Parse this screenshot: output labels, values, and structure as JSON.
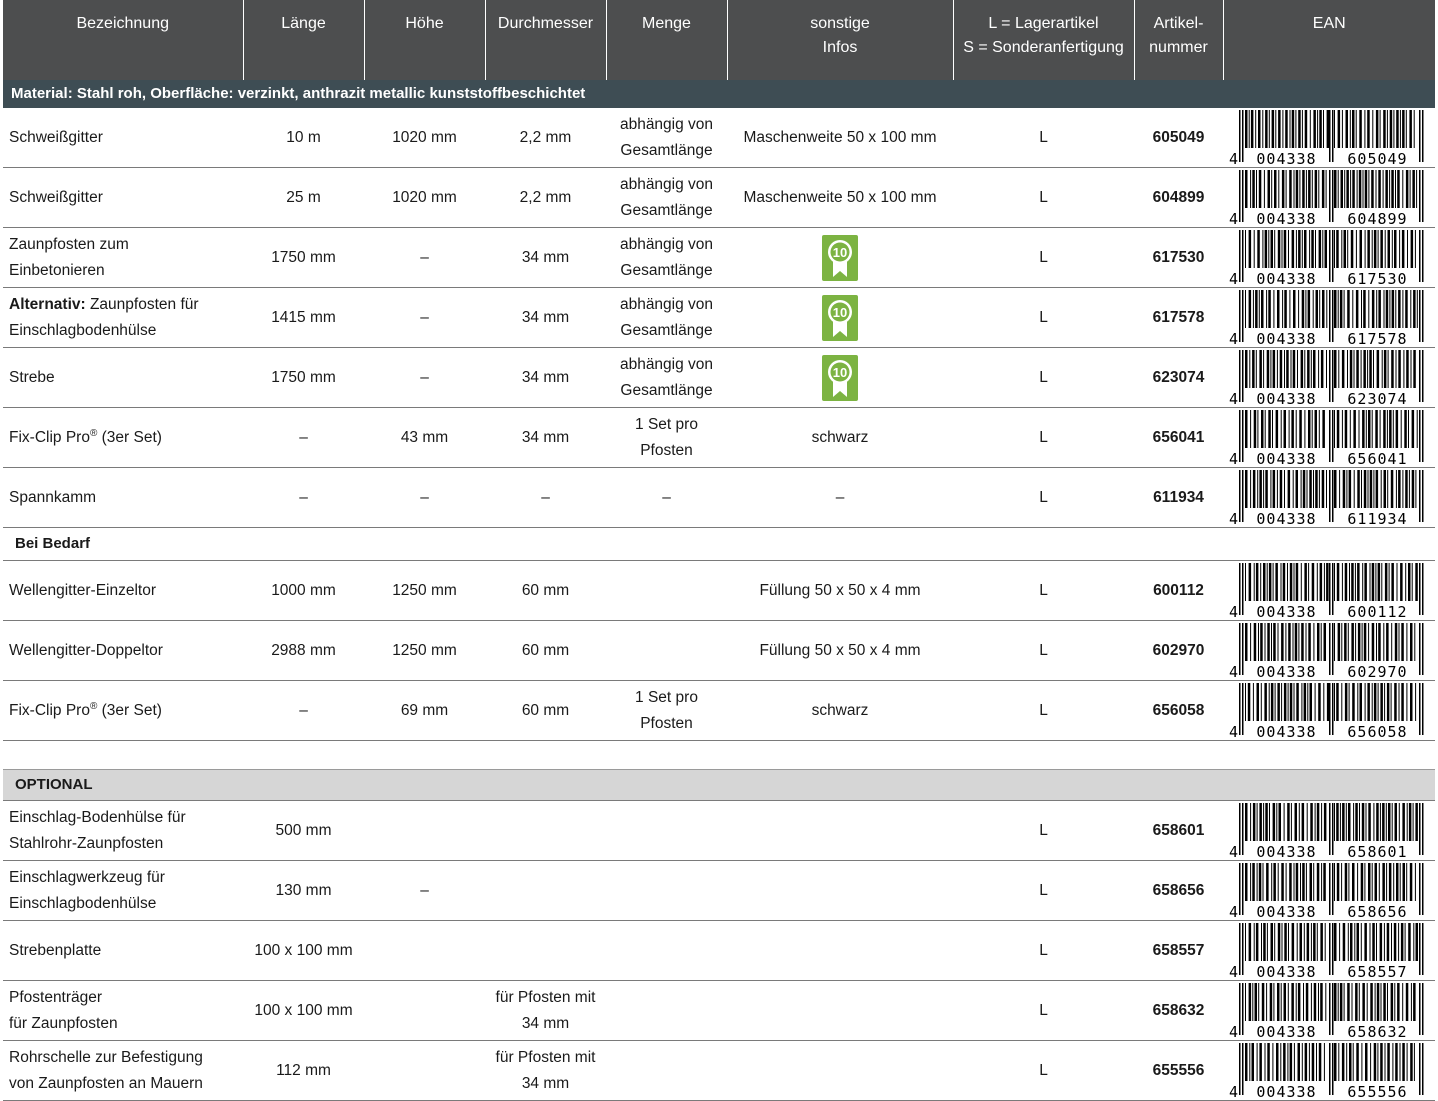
{
  "headers": {
    "bezeichnung": "Bezeichnung",
    "laenge": "Länge",
    "hoehe": "Höhe",
    "durchmesser": "Durchmesser",
    "menge": "Menge",
    "infos_1": "sonstige",
    "infos_2": "Infos",
    "lager_1": "L = Lagerartikel",
    "lager_2": "S = Sonderanfertigung",
    "artikel_1": "Artikel-",
    "artikel_2": "nummer",
    "ean": "EAN"
  },
  "sections": {
    "material": "Material: Stahl roh, Oberfläche: verzinkt, anthrazit metallic kunststoffbeschichtet",
    "bedarf": "Bei Bedarf",
    "optional": "OPTIONAL"
  },
  "award_icon": "award-rosette-10-icon",
  "award_label": "10",
  "accent_green": "#7cb342",
  "rows": [
    {
      "name1": "Schweißgitter",
      "name2": "",
      "laenge": "10 m",
      "hoehe": "1020 mm",
      "durchmesser": "2,2 mm",
      "menge1": "abhängig von",
      "menge2": "Gesamtlänge",
      "infos": "Maschenweite 50 x 100 mm",
      "lager": "L",
      "artikel": "605049",
      "ean_prefix": "4",
      "ean_mid": "004338",
      "ean_end": "605049"
    },
    {
      "name1": "Schweißgitter",
      "name2": "",
      "laenge": "25 m",
      "hoehe": "1020 mm",
      "durchmesser": "2,2 mm",
      "menge1": "abhängig von",
      "menge2": "Gesamtlänge",
      "infos": "Maschenweite 50 x 100 mm",
      "lager": "L",
      "artikel": "604899",
      "ean_prefix": "4",
      "ean_mid": "004338",
      "ean_end": "604899"
    },
    {
      "name1": "Zaunpfosten zum",
      "name2": "Einbetonieren",
      "laenge": "1750 mm",
      "hoehe": "–",
      "durchmesser": "34 mm",
      "menge1": "abhängig von",
      "menge2": "Gesamtlänge",
      "infos": "",
      "lager": "L",
      "artikel": "617530",
      "ean_prefix": "4",
      "ean_mid": "004338",
      "ean_end": "617530"
    },
    {
      "name_bold": "Alternativ:",
      "name1": " Zaunpfosten für",
      "name2": "Einschlagbodenhülse",
      "laenge": "1415 mm",
      "hoehe": "–",
      "durchmesser": "34 mm",
      "menge1": "abhängig von",
      "menge2": "Gesamtlänge",
      "infos": "",
      "lager": "L",
      "artikel": "617578",
      "ean_prefix": "4",
      "ean_mid": "004338",
      "ean_end": "617578"
    },
    {
      "name1": "Strebe",
      "name2": "",
      "laenge": "1750 mm",
      "hoehe": "–",
      "durchmesser": "34 mm",
      "menge1": "abhängig von",
      "menge2": "Gesamtlänge",
      "infos": "",
      "lager": "L",
      "artikel": "623074",
      "ean_prefix": "4",
      "ean_mid": "004338",
      "ean_end": "623074"
    },
    {
      "name1": "Fix-Clip Pro",
      "name_sup": "®",
      "name1b": " (3er Set)",
      "name2": "",
      "laenge": "–",
      "hoehe": "43 mm",
      "durchmesser": "34 mm",
      "menge1": "1 Set pro",
      "menge2": "Pfosten",
      "infos": "schwarz",
      "lager": "L",
      "artikel": "656041",
      "ean_prefix": "4",
      "ean_mid": "004338",
      "ean_end": "656041"
    },
    {
      "name1": "Spannkamm",
      "name2": "",
      "laenge": "–",
      "hoehe": "–",
      "durchmesser": "–",
      "menge1": "–",
      "menge2": "",
      "infos": "–",
      "lager": "L",
      "artikel": "611934",
      "ean_prefix": "4",
      "ean_mid": "004338",
      "ean_end": "611934"
    },
    {
      "name1": "Wellengitter-Einzeltor",
      "name2": "",
      "laenge": "1000 mm",
      "hoehe": "1250 mm",
      "durchmesser": "60 mm",
      "menge1": "",
      "menge2": "",
      "infos": "Füllung 50 x 50 x 4 mm",
      "lager": "L",
      "artikel": "600112",
      "ean_prefix": "4",
      "ean_mid": "004338",
      "ean_end": "600112"
    },
    {
      "name1": "Wellengitter-Doppeltor",
      "name2": "",
      "laenge": "2988 mm",
      "hoehe": "1250 mm",
      "durchmesser": "60 mm",
      "menge1": "",
      "menge2": "",
      "infos": "Füllung 50 x 50 x 4 mm",
      "lager": "L",
      "artikel": "602970",
      "ean_prefix": "4",
      "ean_mid": "004338",
      "ean_end": "602970"
    },
    {
      "name1": "Fix-Clip Pro",
      "name_sup": "®",
      "name1b": " (3er Set)",
      "name2": "",
      "laenge": "–",
      "hoehe": "69 mm",
      "durchmesser": "60 mm",
      "menge1": "1 Set pro",
      "menge2": "Pfosten",
      "infos": "schwarz",
      "lager": "L",
      "artikel": "656058",
      "ean_prefix": "4",
      "ean_mid": "004338",
      "ean_end": "656058"
    },
    {
      "name1": "Einschlag-Bodenhülse für",
      "name2": "Stahlrohr-Zaunpfosten",
      "laenge": "500 mm",
      "hoehe": "",
      "durchmesser1": "",
      "durchmesser2": "",
      "menge1": "",
      "menge2": "",
      "infos": "",
      "lager": "L",
      "artikel": "658601",
      "ean_prefix": "4",
      "ean_mid": "004338",
      "ean_end": "658601"
    },
    {
      "name1": "Einschlagwerkzeug für",
      "name2": "Einschlagbodenhülse",
      "laenge": "130 mm",
      "hoehe": "–",
      "durchmesser1": "",
      "durchmesser2": "",
      "menge1": "",
      "menge2": "",
      "infos": "",
      "lager": "L",
      "artikel": "658656",
      "ean_prefix": "4",
      "ean_mid": "004338",
      "ean_end": "658656"
    },
    {
      "name1": "Strebenplatte",
      "name2": "",
      "laenge": "100 x 100 mm",
      "hoehe": "",
      "durchmesser1": "",
      "durchmesser2": "",
      "menge1": "",
      "menge2": "",
      "infos": "",
      "lager": "L",
      "artikel": "658557",
      "ean_prefix": "4",
      "ean_mid": "004338",
      "ean_end": "658557"
    },
    {
      "name1": "Pfostenträger",
      "name2": "für Zaunpfosten",
      "laenge": "100 x 100 mm",
      "hoehe": "",
      "durchmesser1": "für Pfosten mit",
      "durchmesser2": "34 mm",
      "menge1": "",
      "menge2": "",
      "infos": "",
      "lager": "L",
      "artikel": "658632",
      "ean_prefix": "4",
      "ean_mid": "004338",
      "ean_end": "658632"
    },
    {
      "name1": "Rohrschelle zur Befestigung",
      "name2": "von Zaunpfosten an Mauern",
      "laenge": "112 mm",
      "hoehe": "",
      "durchmesser1": "für Pfosten mit",
      "durchmesser2": "34 mm",
      "menge1": "",
      "menge2": "",
      "infos": "",
      "lager": "L",
      "artikel": "655556",
      "ean_prefix": "4",
      "ean_mid": "004338",
      "ean_end": "655556"
    }
  ]
}
